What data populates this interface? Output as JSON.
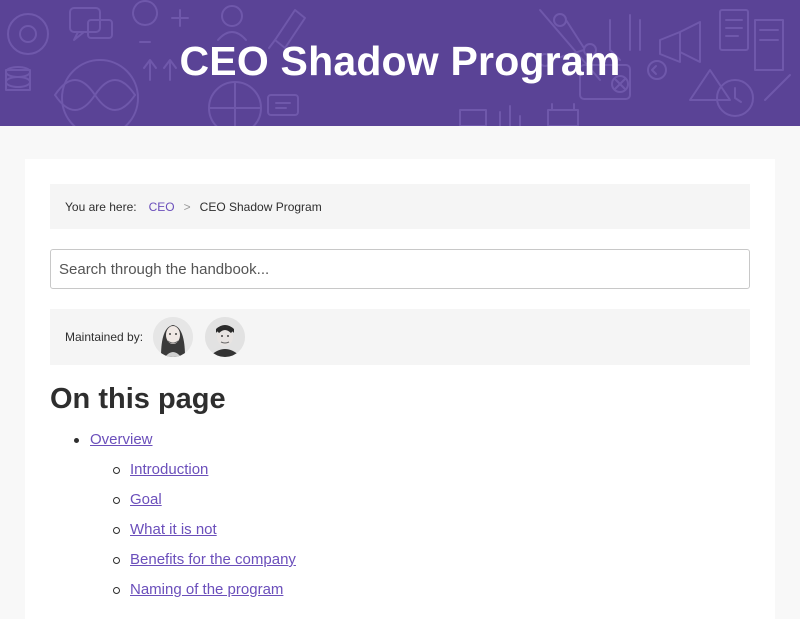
{
  "hero": {
    "title": "CEO Shadow Program",
    "background_color": "#5a4396"
  },
  "breadcrumb": {
    "lead": "You are here:",
    "items": [
      {
        "label": "CEO",
        "link": true
      },
      {
        "label": "CEO Shadow Program",
        "link": false
      }
    ],
    "separator": ">"
  },
  "search": {
    "placeholder": "Search through the handbook..."
  },
  "maintainers": {
    "label": "Maintained by:",
    "avatars": [
      "avatar-woman",
      "avatar-man"
    ]
  },
  "toc": {
    "title": "On this page",
    "items": [
      {
        "label": "Overview",
        "level": 1
      },
      {
        "label": "Introduction",
        "level": 2
      },
      {
        "label": "Goal",
        "level": 2
      },
      {
        "label": "What it is not",
        "level": 2
      },
      {
        "label": "Benefits for the company",
        "level": 2
      },
      {
        "label": "Naming of the program",
        "level": 2
      }
    ]
  },
  "colors": {
    "link": "#6b4fbb",
    "panel": "#f5f5f5"
  }
}
